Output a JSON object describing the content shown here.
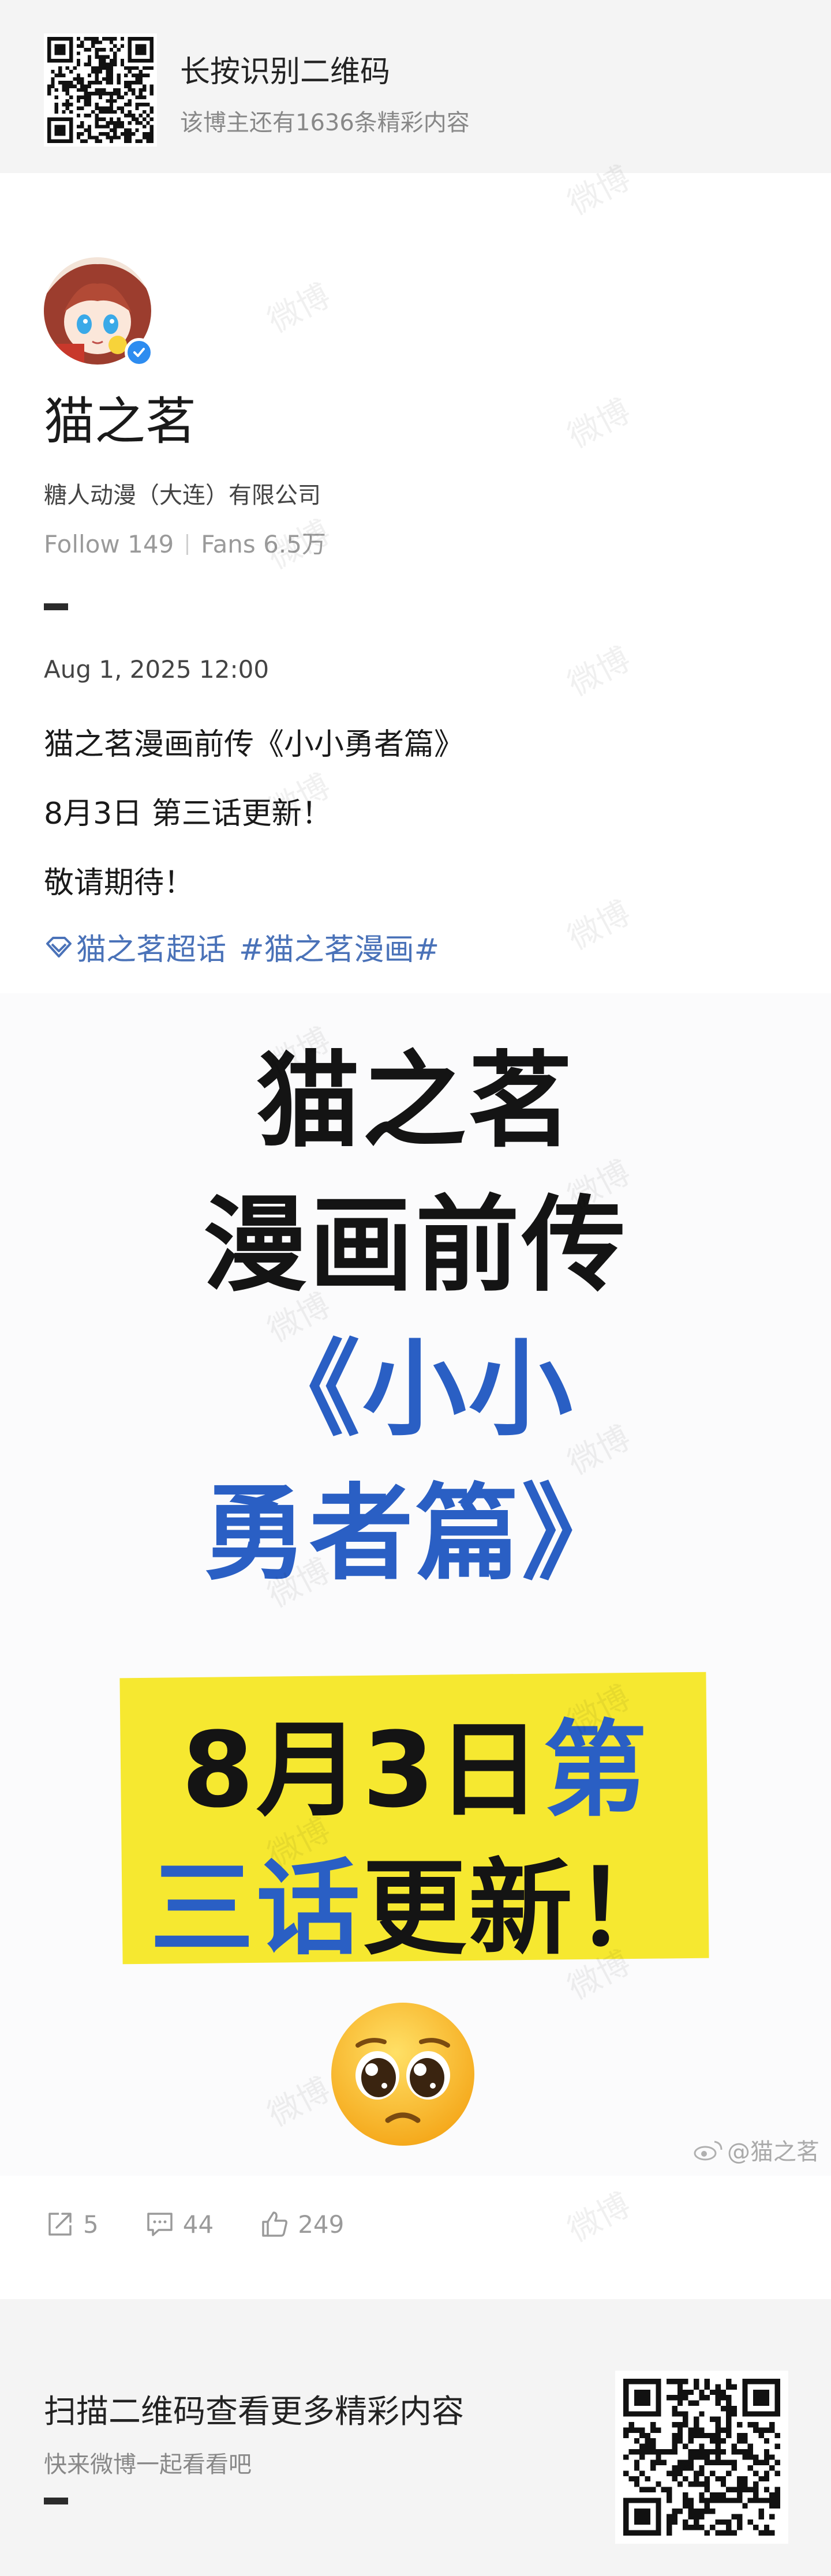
{
  "top_banner": {
    "title": "长按识别二维码",
    "subtitle": "该博主还有1636条精彩内容"
  },
  "author": {
    "name": "猫之茗",
    "company": "糖人动漫（大连）有限公司",
    "follow_label": "Follow 149",
    "fans_label": "Fans 6.5万",
    "verified": true
  },
  "post": {
    "date": "Aug 1, 2025 12:00",
    "lines": [
      "猫之茗漫画前传《小小勇者篇》",
      "8月3日 第三话更新！",
      "敬请期待！"
    ],
    "tags": [
      "猫之茗超话",
      "#猫之茗漫画#"
    ]
  },
  "poster": {
    "line1": "猫之茗",
    "line2": "漫画前传",
    "line3": "《小小",
    "line4": "勇者篇》",
    "line5_black": "8月3日",
    "line5_blue": "第",
    "line6_blue": "三话",
    "line6_black": "更新！",
    "watermark": "@猫之茗"
  },
  "actions": {
    "share_count": "5",
    "comment_count": "44",
    "like_count": "249"
  },
  "bottom_banner": {
    "title": "扫描二维码查看更多精彩内容",
    "subtitle": "快来微博一起看看吧"
  },
  "watermark_text": "微博",
  "colors": {
    "tag_blue": "#4a72b8",
    "poster_blue": "#2a5fc4",
    "poster_yellow": "#f6e830",
    "verify_blue": "#2d8cf0"
  }
}
